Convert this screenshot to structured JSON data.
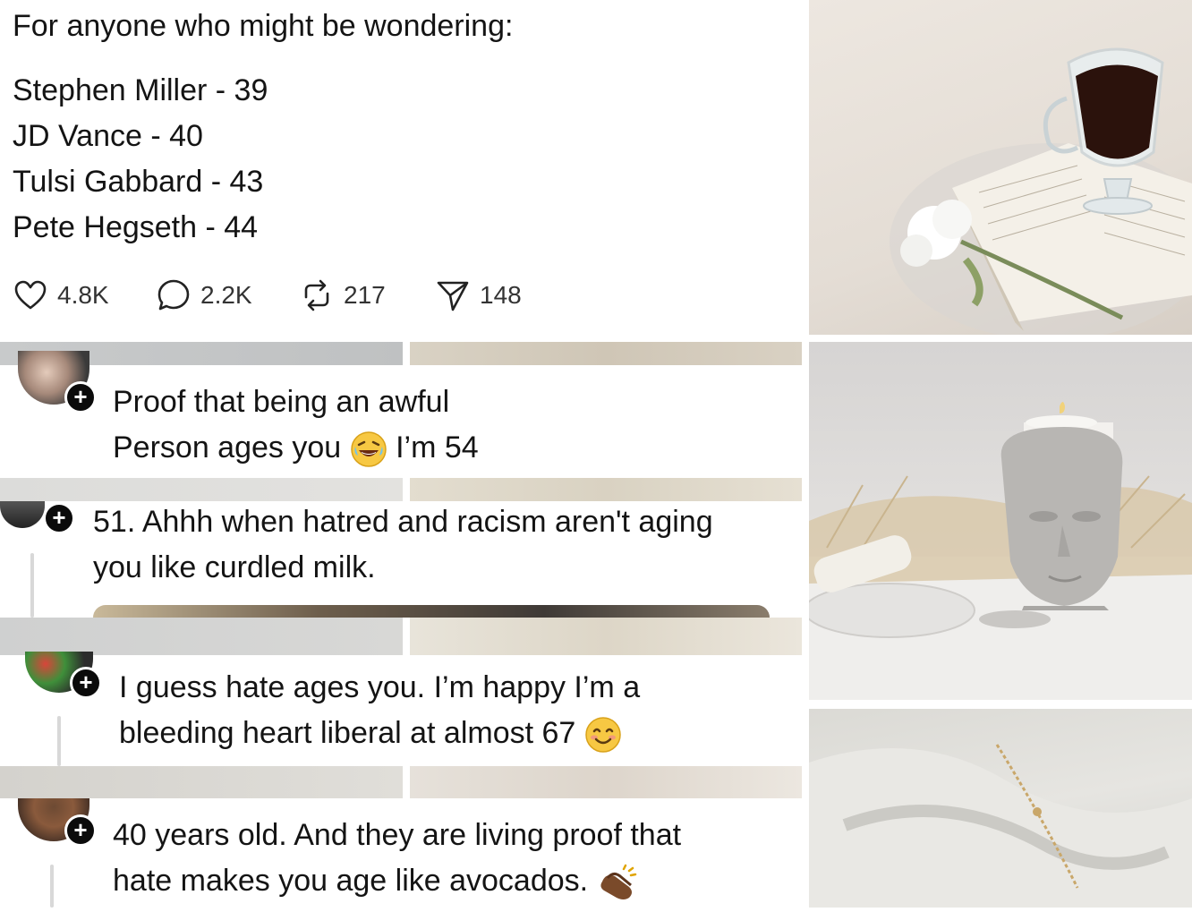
{
  "post": {
    "intro": "For anyone who might be wondering:",
    "lines": [
      "Stephen Miller - 39",
      "JD Vance - 40",
      "Tulsi Gabbard - 43",
      "Pete Hegseth - 44"
    ],
    "actions": {
      "likes": "4.8K",
      "replies": "2.2K",
      "reposts": "217",
      "shares": "148"
    }
  },
  "comments": [
    {
      "line1": "Proof that being an awful",
      "line2": "Person ages you",
      "line2_after": "I’m 54"
    },
    {
      "line1": "51. Ahhh when hatred and racism aren't aging",
      "line2": "you like curdled milk."
    },
    {
      "line1": "I guess hate ages you. I’m happy I’m a",
      "line2": "bleeding heart liberal at almost 67"
    },
    {
      "line1": "40 years old. And they are living proof that",
      "line2": "hate makes you age like avocados."
    }
  ],
  "icons": [
    "heart-icon",
    "comment-icon",
    "repost-icon",
    "share-icon",
    "follow-plus-icon",
    "laughing-emoji-icon",
    "smiling-emoji-icon",
    "clapping-hands-emoji-icon"
  ],
  "colors": {
    "text": "#141414",
    "panel_beige": "#e8e3dc",
    "panel_grey": "#dcdcda"
  }
}
